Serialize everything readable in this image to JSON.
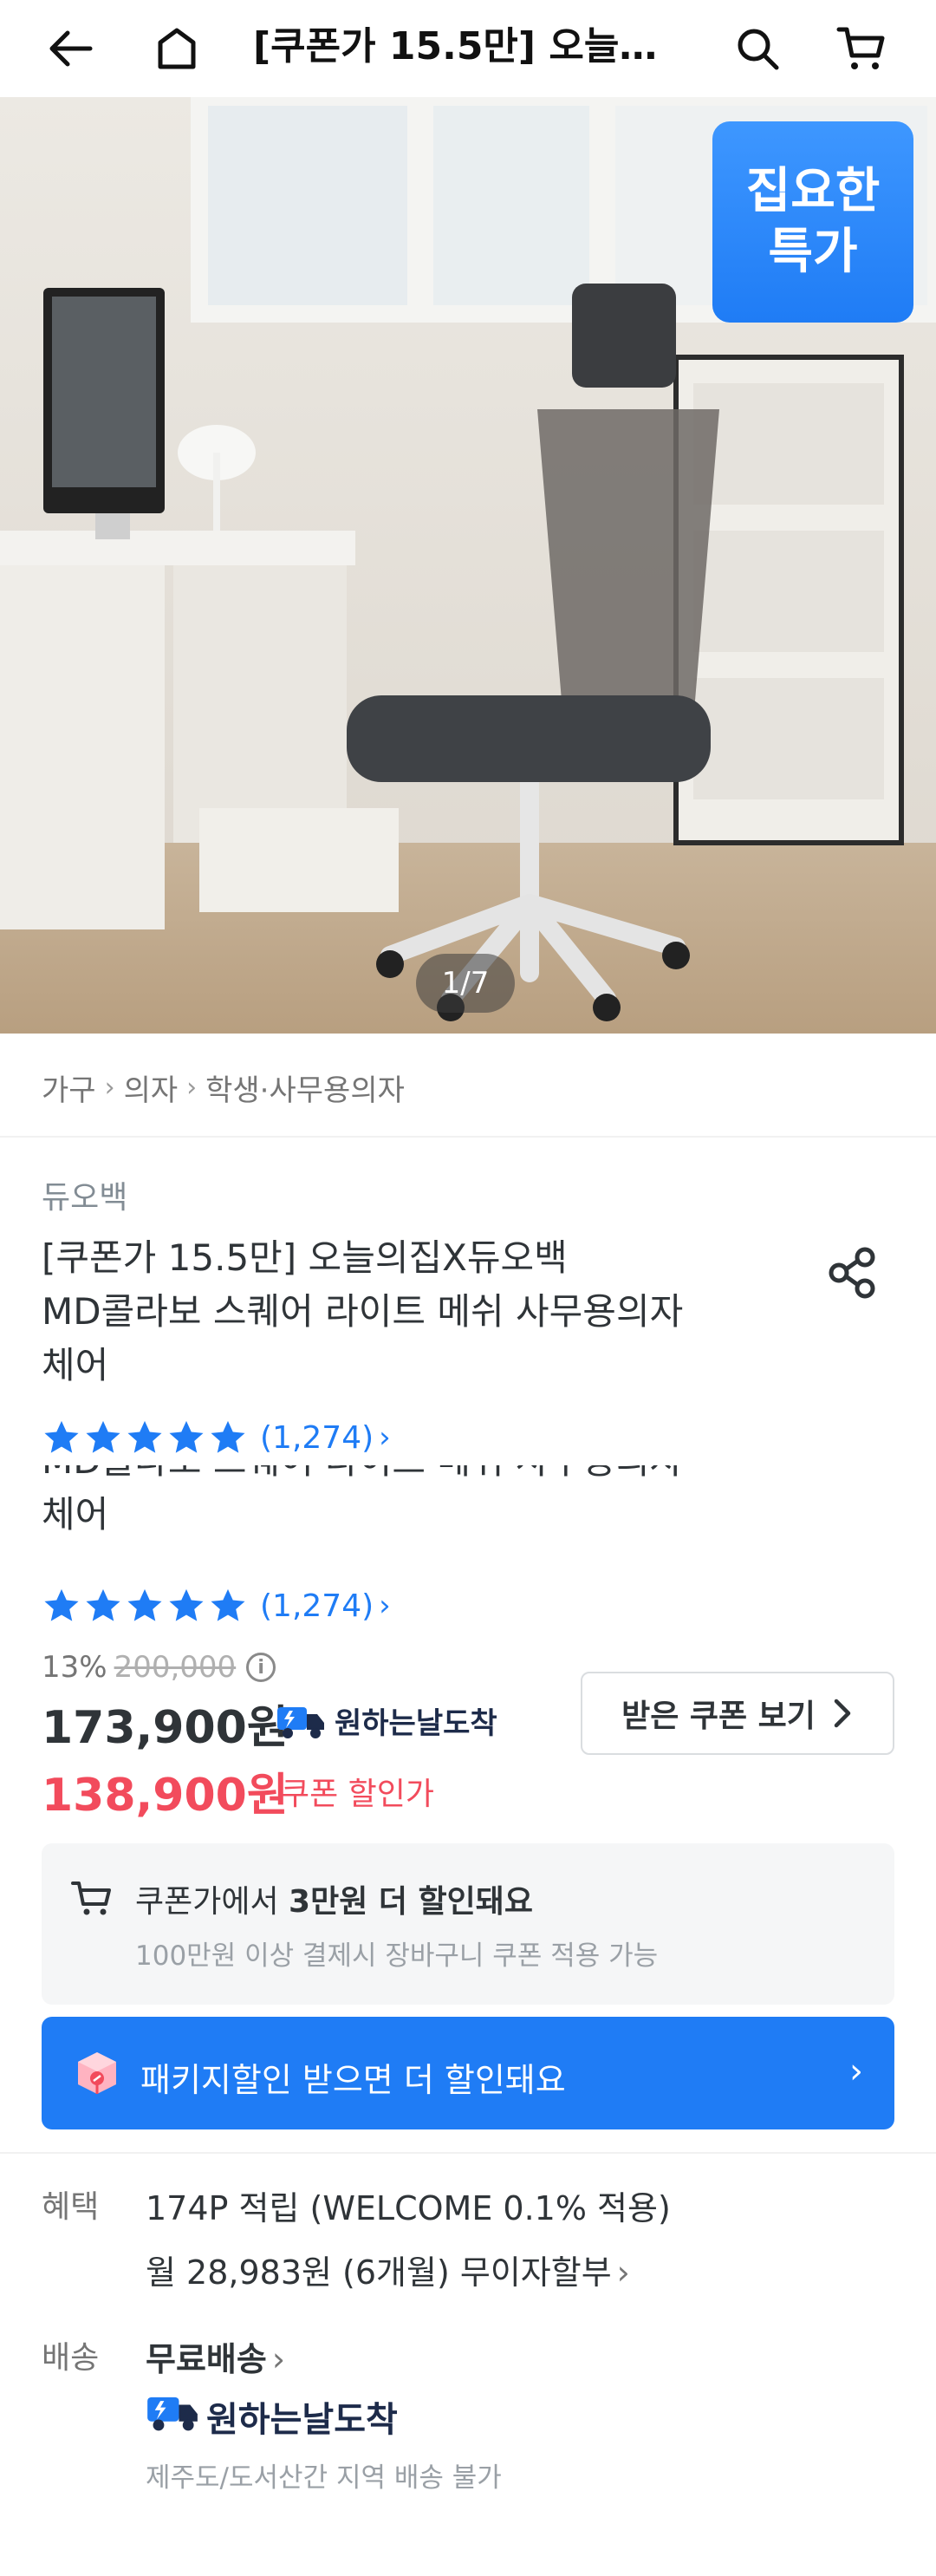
{
  "header": {
    "title": "[쿠폰가 15.5만] 오늘…",
    "back_icon": "back-arrow-icon",
    "home_icon": "home-icon",
    "search_icon": "search-icon",
    "cart_icon": "cart-icon"
  },
  "hero": {
    "badge_line1": "집요한",
    "badge_line2": "특가",
    "counter": "1/7"
  },
  "breadcrumb": [
    "가구",
    "의자",
    "학생·사무용의자"
  ],
  "product": {
    "brand": "듀오백",
    "title_line1": "[쿠폰가 15.5만] 오늘의집X듀오백",
    "title_line2": "MD콜라보 스퀘어 라이트 메쉬 사무용의자",
    "title_line3": "체어",
    "rating_count": "(1,274)",
    "rating_stars": 5,
    "ghost_line1": "MD콜라보 스퀘어 라이트 메쉬 사무용의자",
    "ghost_line2": "체어"
  },
  "pricing": {
    "discount_pct": "13%",
    "original_price": "200,000",
    "price": "173,900원",
    "delivery_tag": "원하는날도착",
    "coupon_button": "받은 쿠폰 보기",
    "coupon_price": "138,900원",
    "coupon_label": "쿠폰 할인가"
  },
  "coupon_info": {
    "prefix": "쿠폰가에서 ",
    "highlight": "3만원 더 할인돼요",
    "sub": "100만원 이상 결제시 장바구니 쿠폰 적용 가능"
  },
  "package_banner": {
    "text": "패키지할인 받으면 더 할인돼요"
  },
  "benefits": {
    "label": "혜택",
    "points": "174P 적립 (WELCOME 0.1% 적용)",
    "installment": "월 28,983원 (6개월) 무이자할부"
  },
  "shipping": {
    "label": "배송",
    "free": "무료배송",
    "delivery_tag": "원하는날도착",
    "note": "제주도/도서산간 지역 배송 불가"
  },
  "colors": {
    "accent": "#1f7cf5",
    "coupon_red": "#f24b5c",
    "star": "#1f7cf5"
  }
}
